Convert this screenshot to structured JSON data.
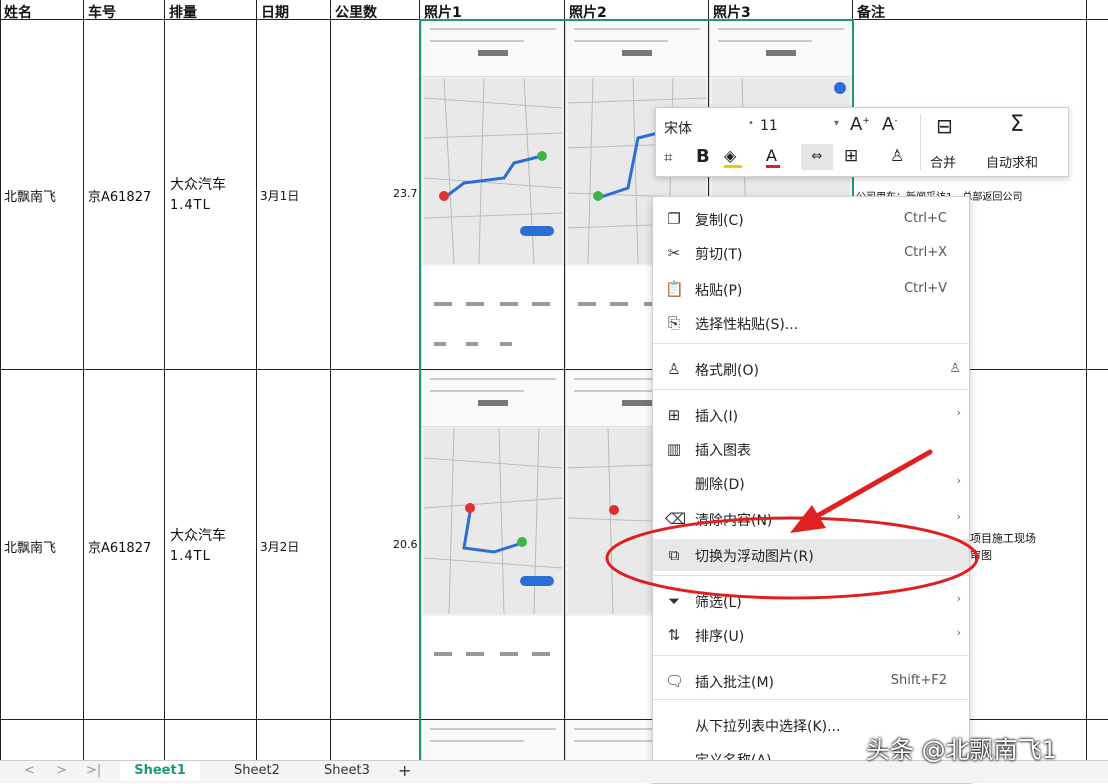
{
  "headers": [
    "姓名",
    "车号",
    "排量",
    "日期",
    "公里数",
    "照片1",
    "照片2",
    "照片3",
    "备注"
  ],
  "rows": [
    {
      "name": "北飘南飞",
      "plate": "京A61827",
      "disp_line1": "大众汽车",
      "disp_line2": "1.4TL",
      "date": "3月1日",
      "km": "23.7",
      "note": "公司用车：新闻采访1，总部返回公司"
    },
    {
      "name": "北飘南飞",
      "plate": "京A61827",
      "disp_line1": "大众汽车",
      "disp_line2": "1.4TL",
      "date": "3月2日",
      "km": "20.6",
      "note_line1": "项目施工现场",
      "note_line2": "审图"
    }
  ],
  "toolbar": {
    "font_name": "宋体",
    "font_size": "11",
    "merge_label": "合并",
    "autosum_label": "自动求和"
  },
  "context_menu": [
    {
      "label": "复制(C)",
      "shortcut": "Ctrl+C",
      "icon": "copy-icon",
      "glyph": "❐"
    },
    {
      "label": "剪切(T)",
      "shortcut": "Ctrl+X",
      "icon": "scissors-icon",
      "glyph": "✂"
    },
    {
      "label": "粘贴(P)",
      "shortcut": "Ctrl+V",
      "icon": "paste-icon",
      "glyph": "📋"
    },
    {
      "label": "选择性粘贴(S)...",
      "shortcut": "",
      "icon": "paste-special-icon",
      "glyph": "⎘"
    },
    {
      "label": "格式刷(O)",
      "shortcut": "",
      "icon": "format-painter-icon",
      "glyph": "♙"
    },
    {
      "label": "插入(I)",
      "shortcut": "",
      "icon": "insert-icon",
      "glyph": "⊞"
    },
    {
      "label": "插入图表",
      "shortcut": "",
      "icon": "chart-icon",
      "glyph": "▥"
    },
    {
      "label": "删除(D)",
      "shortcut": "",
      "icon": "",
      "glyph": ""
    },
    {
      "label": "清除内容(N)",
      "shortcut": "",
      "icon": "eraser-icon",
      "glyph": "⌫"
    },
    {
      "label": "切换为浮动图片(R)",
      "shortcut": "",
      "icon": "float-image-icon",
      "glyph": "⧉"
    },
    {
      "label": "筛选(L)",
      "shortcut": "",
      "icon": "filter-icon",
      "glyph": "⏷"
    },
    {
      "label": "排序(U)",
      "shortcut": "",
      "icon": "sort-icon",
      "glyph": "⇅"
    },
    {
      "label": "插入批注(M)",
      "shortcut": "Shift+F2",
      "icon": "comment-icon",
      "glyph": "🗨"
    },
    {
      "label": "从下拉列表中选择(K)...",
      "shortcut": "",
      "icon": "",
      "glyph": ""
    },
    {
      "label": "定义名称(A)...",
      "shortcut": "",
      "icon": "",
      "glyph": ""
    }
  ],
  "sheet_tabs": [
    "Sheet1",
    "Sheet2",
    "Sheet3"
  ],
  "active_tab": "Sheet1",
  "watermark": "头条 @北飘南飞1",
  "colors": {
    "selection": "#1f9a6e",
    "annotation": "#e02020",
    "active_tab": "#1f9a6e",
    "font_color_bar": "#e02020",
    "fill_color_bar": "#f3c400"
  }
}
